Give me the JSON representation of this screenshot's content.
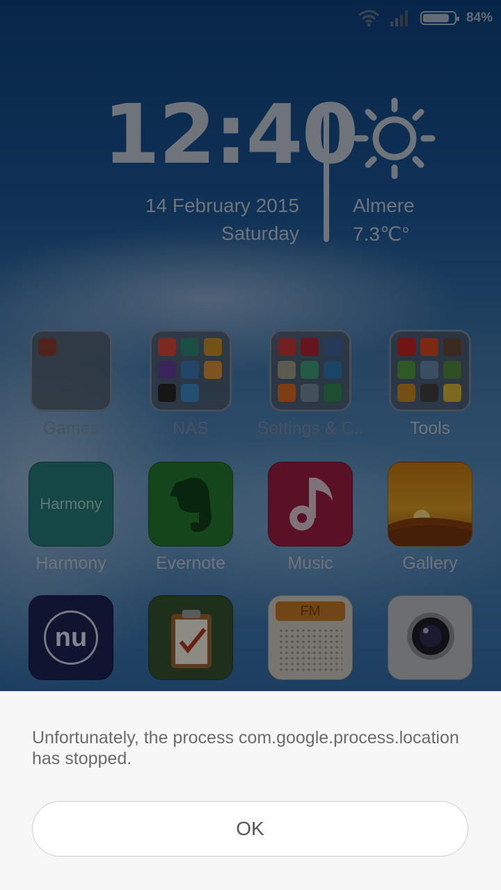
{
  "status_bar": {
    "battery_percent": "84%",
    "battery_level": 0.84,
    "icons": [
      "wifi-icon",
      "signal-icon",
      "battery-icon"
    ]
  },
  "clock": {
    "time": "12:40",
    "date": "14 February 2015",
    "day": "Saturday"
  },
  "weather": {
    "city": "Almere",
    "temperature": "7.3℃°",
    "icon": "sun-icon"
  },
  "apps": {
    "row1": [
      {
        "label": "Games",
        "type": "folder"
      },
      {
        "label": "NAS",
        "type": "folder"
      },
      {
        "label": "Settings & C..",
        "type": "folder"
      },
      {
        "label": "Tools",
        "type": "folder"
      }
    ],
    "row2": [
      {
        "label": "Harmony",
        "icon_text": "Harmony"
      },
      {
        "label": "Evernote"
      },
      {
        "label": "Music"
      },
      {
        "label": "Gallery"
      }
    ],
    "row3": [
      {
        "label": "",
        "icon_text": "nu"
      },
      {
        "label": ""
      },
      {
        "label": "",
        "icon_text": "FM"
      },
      {
        "label": ""
      }
    ]
  },
  "dialog": {
    "message": "Unfortunately, the process com.google.process.location has stopped.",
    "ok_label": "OK"
  },
  "colors": {
    "dialog_bg": "#f7f7f7",
    "harmony": "#2a8f8a",
    "evernote": "#2f8a3a",
    "music": "#b0224a",
    "gallery": "#e08a10"
  }
}
